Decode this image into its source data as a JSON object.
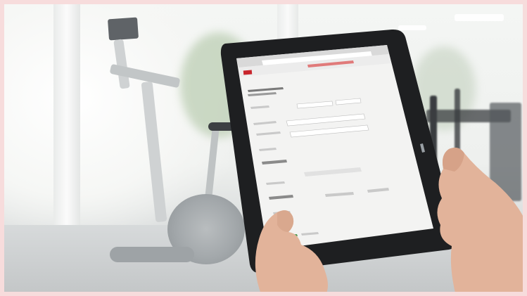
{
  "scene": {
    "description_free": true,
    "colors": {
      "border": "#f7dcdc",
      "tablet_bezel": "#1e1f21",
      "screen": "#f3f3f2",
      "brand_red": "#c8262d",
      "skin": "#e2b39a"
    }
  },
  "icons": [
    "logo-icon"
  ]
}
